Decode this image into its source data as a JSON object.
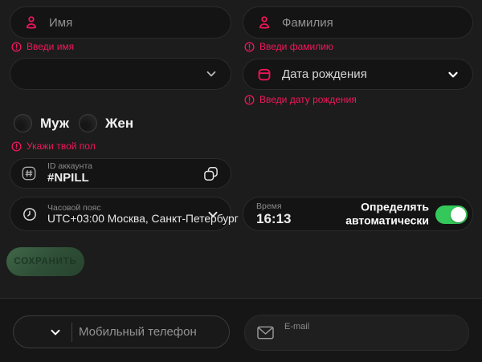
{
  "colors": {
    "page_background": "#1C1C1C",
    "field_background": "#141414",
    "accent_pink": "#ED1559",
    "error_text": "#F2175C",
    "toggle_green": "#34C759",
    "save_button_green": "#2E4E36"
  },
  "profile_form": {
    "first_name": {
      "placeholder": "Имя",
      "error": "Введи имя",
      "icon": "person-icon"
    },
    "last_name": {
      "placeholder": "Фамилия",
      "error": "Введи фамилию",
      "icon": "person-icon"
    },
    "extra_select": {
      "value": "",
      "icon": "chevron-down-icon"
    },
    "birth_date": {
      "placeholder": "Дата рождения",
      "error": "Введи дату рождения",
      "icon": "calendar-icon"
    },
    "gender": {
      "options": [
        {
          "label": "Муж"
        },
        {
          "label": "Жен"
        }
      ],
      "error": "Укажи твой пол"
    },
    "account_id": {
      "label": "ID аккаунта",
      "value": "#NPILL",
      "lead_icon": "hash-icon",
      "action_icon": "copy-icon"
    },
    "timezone": {
      "label": "Часовой пояс",
      "value": "UTC+03:00 Москва, Санкт-Петербург",
      "icon": "clock-icon"
    },
    "time": {
      "label": "Время",
      "value": "16:13",
      "auto_detect_label": "Определять автоматически",
      "auto_detect_on": true
    },
    "save_button_label": "СОХРАНИТЬ"
  },
  "contacts_form": {
    "phone": {
      "placeholder": "Мобильный телефон",
      "icon": "chevron-down-icon"
    },
    "email": {
      "label": "E-mail",
      "icon": "mail-icon"
    }
  }
}
